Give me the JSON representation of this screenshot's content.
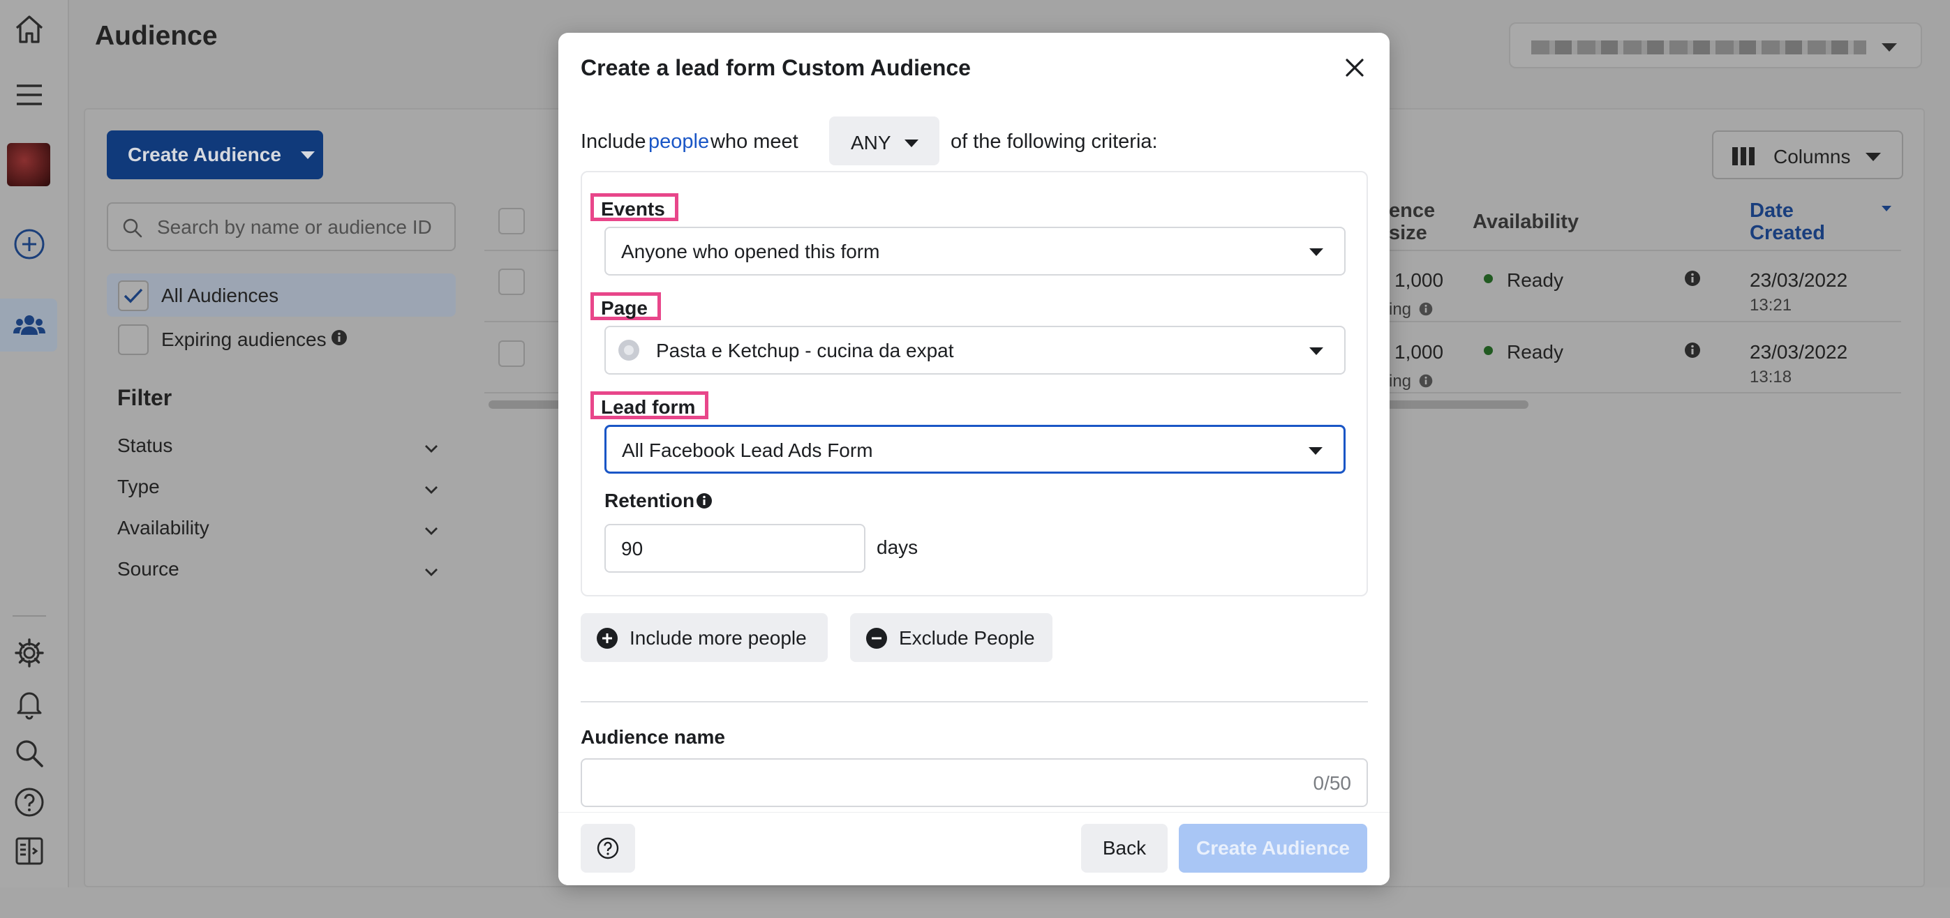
{
  "page": {
    "title": "Audience"
  },
  "toolbar": {
    "create_audience_label": "Create Audience",
    "search_placeholder": "Search by name or audience ID",
    "columns_label": "Columns"
  },
  "audience_filters": [
    {
      "label": "All Audiences",
      "checked": true
    },
    {
      "label": "Expiring audiences",
      "checked": false
    }
  ],
  "filter_panel": {
    "title": "Filter",
    "items": [
      "Status",
      "Type",
      "Availability",
      "Source"
    ]
  },
  "table": {
    "columns": [
      "ence",
      "size",
      "Availability",
      "Date",
      "Created"
    ],
    "rows": [
      {
        "size": "1,000",
        "size_note": "ing",
        "availability": "Ready",
        "date": "23/03/2022",
        "time": "13:21"
      },
      {
        "size": "1,000",
        "size_note": "ing",
        "availability": "Ready",
        "date": "23/03/2022",
        "time": "13:18"
      }
    ]
  },
  "modal": {
    "title": "Create a lead form Custom Audience",
    "criteria_prefix": "Include",
    "criteria_link": "people",
    "criteria_mid": "who meet",
    "match_value": "ANY",
    "criteria_suffix": "of the following criteria:",
    "events_label": "Events",
    "events_value": "Anyone who opened this form",
    "page_label": "Page",
    "page_value": "Pasta e Ketchup - cucina da expat",
    "lead_form_label": "Lead form",
    "lead_form_value": "All Facebook Lead Ads Form",
    "retention_label": "Retention",
    "retention_value": "90",
    "retention_unit": "days",
    "include_more_label": "Include more people",
    "exclude_label": "Exclude People",
    "audience_name_label": "Audience name",
    "audience_name_counter": "0/50",
    "back_label": "Back",
    "submit_label": "Create Audience"
  },
  "colors": {
    "highlight_border": "#e8468a",
    "link_blue": "#1a56c6",
    "primary_disabled": "#a9c6f5",
    "ready_green": "#215a21"
  }
}
